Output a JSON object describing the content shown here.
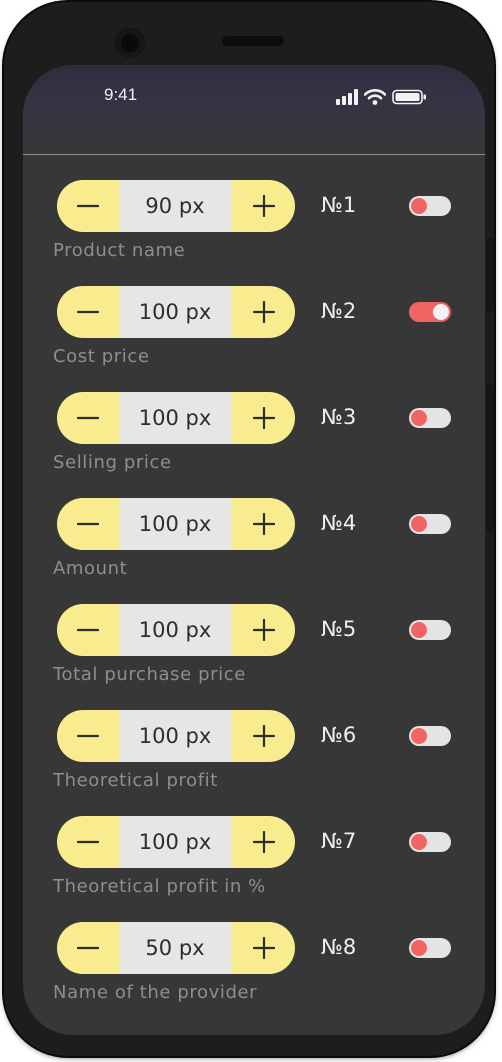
{
  "status_bar": {
    "time": "9:41"
  },
  "icons": {
    "signal": "cellular-signal-icon",
    "wifi": "wifi-icon",
    "battery": "battery-icon",
    "minus": "minus-icon",
    "plus": "plus-icon"
  },
  "colors": {
    "stepper_bg": "#f8ec8f",
    "value_bg": "#e6e6e6",
    "toggle_accent": "#f06463",
    "screen_bg": "#373737"
  },
  "rows": [
    {
      "value": "90 px",
      "number": "№1",
      "label": "Product name",
      "toggle_on": false
    },
    {
      "value": "100 px",
      "number": "№2",
      "label": "Cost price",
      "toggle_on": true
    },
    {
      "value": "100 px",
      "number": "№3",
      "label": "Selling price",
      "toggle_on": false
    },
    {
      "value": "100 px",
      "number": "№4",
      "label": "Amount",
      "toggle_on": false
    },
    {
      "value": "100 px",
      "number": "№5",
      "label": "Total purchase price",
      "toggle_on": false
    },
    {
      "value": "100 px",
      "number": "№6",
      "label": "Theoretical profit",
      "toggle_on": false
    },
    {
      "value": "100 px",
      "number": "№7",
      "label": "Theoretical profit in %",
      "toggle_on": false
    },
    {
      "value": "50 px",
      "number": "№8",
      "label": "Name of the provider",
      "toggle_on": false
    }
  ]
}
